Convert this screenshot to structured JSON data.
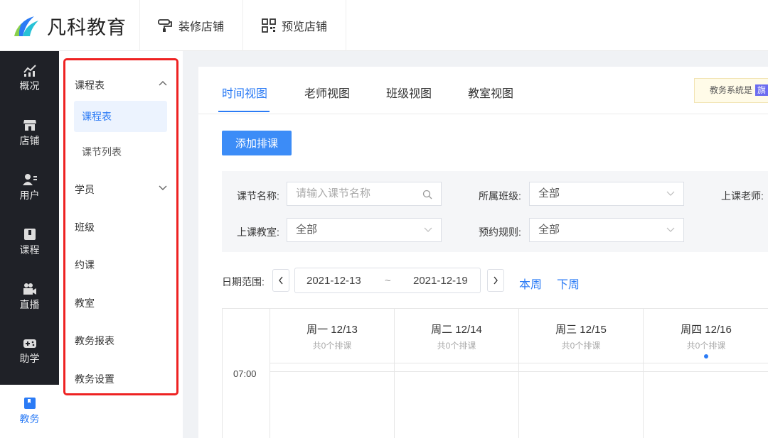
{
  "brand": {
    "name": "凡科教育"
  },
  "header": {
    "decorate_label": "装修店铺",
    "preview_label": "预览店铺"
  },
  "leftnav": [
    {
      "label": "概况",
      "icon": "chart-icon"
    },
    {
      "label": "店铺",
      "icon": "store-icon"
    },
    {
      "label": "用户",
      "icon": "user-icon"
    },
    {
      "label": "课程",
      "icon": "course-icon"
    },
    {
      "label": "直播",
      "icon": "video-icon"
    },
    {
      "label": "助学",
      "icon": "gamepad-icon"
    },
    {
      "label": "教务",
      "icon": "book-icon",
      "active": true
    }
  ],
  "subnav": {
    "schedule": "课程表",
    "schedule_child": "课程表",
    "lesson_list": "课节列表",
    "students": "学员",
    "classes": "班级",
    "booking": "约课",
    "classroom": "教室",
    "reports": "教务报表",
    "settings": "教务设置"
  },
  "tabs": [
    "时间视图",
    "老师视图",
    "班级视图",
    "教室视图"
  ],
  "notice": {
    "text": "教务系统是",
    "tag": "旗"
  },
  "add_button": "添加排课",
  "filters": {
    "lesson_name_label": "课节名称:",
    "lesson_name_placeholder": "请输入课节名称",
    "class_label": "所属班级:",
    "class_value": "全部",
    "teacher_label": "上课老师:",
    "classroom_label": "上课教室:",
    "classroom_value": "全部",
    "rule_label": "预约规则:",
    "rule_value": "全部"
  },
  "date_range": {
    "label": "日期范围:",
    "start": "2021-12-13",
    "sep": "~",
    "end": "2021-12-19",
    "this_week": "本周",
    "next_week": "下周"
  },
  "calendar": {
    "time": "07:00",
    "days": [
      {
        "day": "周一 12/13",
        "count": "共0个排课"
      },
      {
        "day": "周二 12/14",
        "count": "共0个排课"
      },
      {
        "day": "周三 12/15",
        "count": "共0个排课"
      },
      {
        "day": "周四 12/16",
        "count": "共0个排课"
      }
    ]
  },
  "colors": {
    "accent": "#2b7bf5",
    "nav_bg": "#1f2127",
    "highlight": "#e22222"
  }
}
